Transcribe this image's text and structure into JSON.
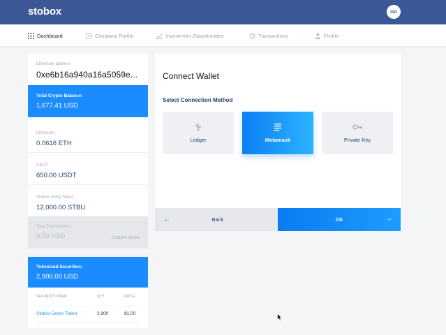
{
  "header": {
    "logo": "stobox",
    "avatar_initials": "GD"
  },
  "nav": [
    {
      "label": "Dashboard",
      "icon": "grid-icon",
      "active": true
    },
    {
      "label": "Company Profile",
      "icon": "building-icon"
    },
    {
      "label": "Investment Opportunities",
      "icon": "chart-icon"
    },
    {
      "label": "Transactions",
      "icon": "history-icon"
    },
    {
      "label": "Profile",
      "icon": "user-icon"
    }
  ],
  "wallet": {
    "address_label": "Ethereum address",
    "address": "0xe6b16a940a16a5059e..."
  },
  "crypto_total": {
    "label": "Total Crypto Balance:",
    "value": "1,677.41 USD"
  },
  "balances": [
    {
      "label": "Ethereum:",
      "value": "0.0616 ETH"
    },
    {
      "label": "USDT:",
      "value": "650.00 USDT"
    },
    {
      "label": "Stobox Utility Token:",
      "value": "12,000.00 STBU"
    }
  ],
  "fiat": {
    "label": "Total Fiat Balance:",
    "value": "0.00 USD",
    "badge": "COMING SOON"
  },
  "securities": {
    "label": "Tokenized Securities:",
    "value": "2,900.00 USD",
    "headers": [
      "SECURITY TOKEN",
      "QTY",
      "PRICE"
    ],
    "rows": [
      {
        "token": "Stobox Demo Token",
        "qty": "2,900",
        "price": "$1.00"
      }
    ]
  },
  "connect": {
    "title": "Connect Wallet",
    "subtitle": "Select Connection Method",
    "methods": [
      {
        "label": "Ledger",
        "icon": "usb-icon",
        "selected": false
      },
      {
        "label": "Metamask",
        "icon": "list-icon",
        "selected": true
      },
      {
        "label": "Private Key",
        "icon": "key-icon",
        "selected": false
      }
    ],
    "back_label": "Back",
    "ok_label": "Ok"
  },
  "colors": {
    "header": "#3b5795",
    "accent": "#1a8cff",
    "text_dark": "#24456b"
  }
}
